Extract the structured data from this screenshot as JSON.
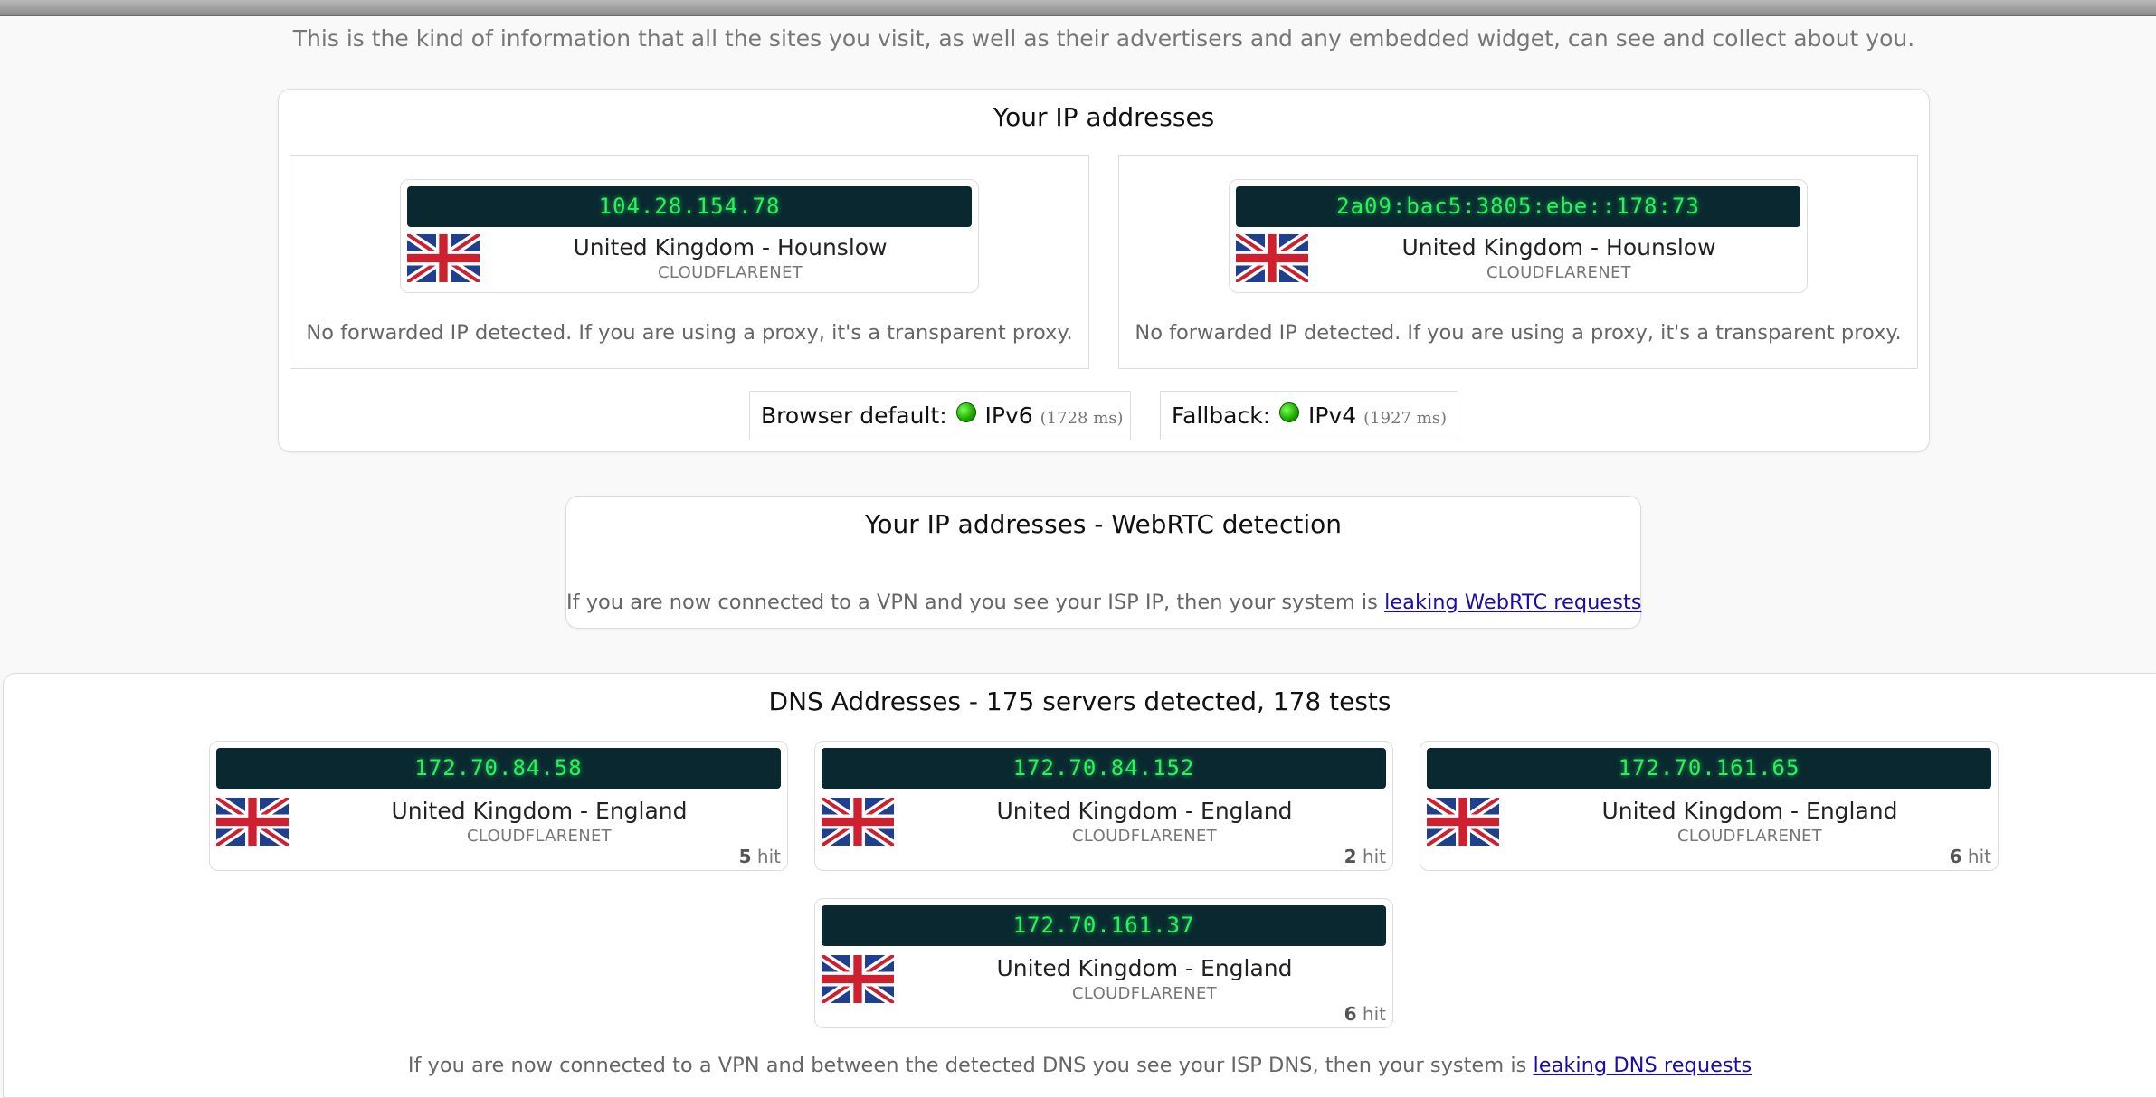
{
  "intro": "This is the kind of information that all the sites you visit, as well as their advertisers and any embedded widget, can see and collect about you.",
  "ip_panel": {
    "title": "Your IP addresses",
    "cards": [
      {
        "ip": "104.28.154.78",
        "location": "United Kingdom - Hounslow",
        "isp": "CLOUDFLARENET",
        "note": "No forwarded IP detected. If you are using a proxy, it's a transparent proxy."
      },
      {
        "ip": "2a09:bac5:3805:ebe::178:73",
        "location": "United Kingdom - Hounslow",
        "isp": "CLOUDFLARENET",
        "note": "No forwarded IP detected. If you are using a proxy, it's a transparent proxy."
      }
    ],
    "protocols": {
      "default_label": "Browser default:",
      "default_value": "IPv6",
      "default_ms": "(1728 ms)",
      "fallback_label": "Fallback:",
      "fallback_value": "IPv4",
      "fallback_ms": "(1927 ms)",
      "status_color": "#1fae00"
    }
  },
  "webrtc": {
    "title": "Your IP addresses - WebRTC detection",
    "note": "If you are now connected to a VPN and you see your ISP IP, then your system is",
    "link": "leaking WebRTC requests"
  },
  "dns": {
    "title": "DNS Addresses - 175 servers detected, 178 tests",
    "servers": [
      {
        "ip": "172.70.84.58",
        "location": "United Kingdom - England",
        "isp": "CLOUDFLARENET",
        "hits": "5",
        "hit_label": "hit"
      },
      {
        "ip": "172.70.84.152",
        "location": "United Kingdom - England",
        "isp": "CLOUDFLARENET",
        "hits": "2",
        "hit_label": "hit"
      },
      {
        "ip": "172.70.161.65",
        "location": "United Kingdom - England",
        "isp": "CLOUDFLARENET",
        "hits": "6",
        "hit_label": "hit"
      },
      {
        "ip": "172.70.161.37",
        "location": "United Kingdom - England",
        "isp": "CLOUDFLARENET",
        "hits": "6",
        "hit_label": "hit"
      }
    ],
    "note": "If you are now connected to a VPN and between the detected DNS you see your ISP DNS, then your system is",
    "link": "leaking DNS requests"
  },
  "colors": {
    "ip_strip_bg": "#0a2830",
    "ip_text": "#2df05c",
    "link": "#1a0dab"
  },
  "icons": {
    "flag": "uk-flag-icon",
    "status": "green-status-dot"
  }
}
